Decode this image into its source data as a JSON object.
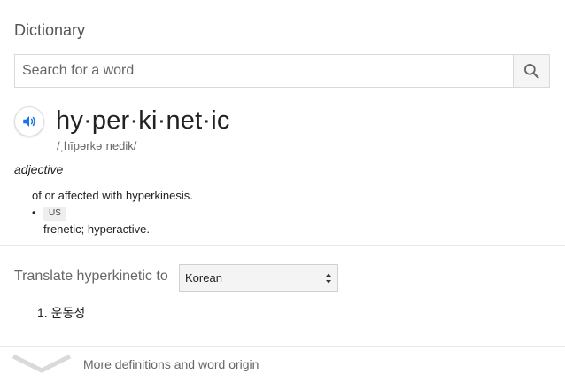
{
  "card": {
    "title": "Dictionary"
  },
  "search": {
    "placeholder": "Search for a word",
    "value": "",
    "button_icon": "search-icon"
  },
  "entry": {
    "audio_icon": "speaker-icon",
    "headword": "hy·per·ki·net·ic",
    "phonetic": "/ˌhīpərkəˈnedik/",
    "part_of_speech": "adjective",
    "definitions": [
      {
        "bullet": "",
        "region": "",
        "text": "of or affected with hyperkinesis."
      },
      {
        "bullet": "•",
        "region": "US",
        "text": "frenetic; hyperactive."
      }
    ]
  },
  "translate": {
    "label": "Translate hyperkinetic to",
    "selected_language": "Korean",
    "results": [
      "1. 운동성"
    ]
  },
  "footer": {
    "expand_icon": "chevron-down-icon",
    "more_label": "More definitions and word origin"
  },
  "colors": {
    "accent": "#1a73e8",
    "text_primary": "#222222",
    "text_secondary": "#666666",
    "divider": "#ebebeb"
  }
}
